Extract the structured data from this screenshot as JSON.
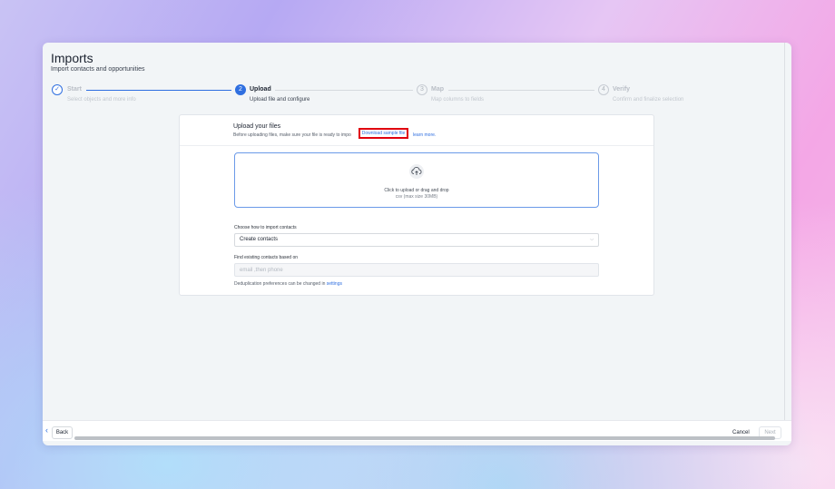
{
  "page": {
    "title": "Imports",
    "subtitle": "Import contacts and opportunities"
  },
  "steps": [
    {
      "number": "✓",
      "title": "Start",
      "desc": "Select objects and more info",
      "state": "done"
    },
    {
      "number": "2",
      "title": "Upload",
      "desc": "Upload file and configure",
      "state": "active"
    },
    {
      "number": "3",
      "title": "Map",
      "desc": "Map columns to fields",
      "state": "todo"
    },
    {
      "number": "4",
      "title": "Verify",
      "desc": "Confirm and finalize selection",
      "state": "todo"
    }
  ],
  "upload": {
    "title": "Upload your files",
    "instruction": "Before uploading files, make sure your file is ready to impo",
    "download_link": "Download sample file",
    "learn_link": "learn more.",
    "icon": "upload-cloud-icon",
    "dropzone_line1": "Click to upload or drag and drop",
    "dropzone_line2": "csv (max size 30MB)"
  },
  "import_mode": {
    "label": "Choose how to import contacts",
    "selected": "Create contacts"
  },
  "dedupe": {
    "label": "Find existing contacts based on",
    "placeholder": "email ,then phone",
    "note_prefix": "Deduplication preferences can be changed in",
    "note_link": "settings"
  },
  "footer": {
    "back": "Back",
    "cancel": "Cancel",
    "next": "Next"
  },
  "colors": {
    "accent": "#2f6fe0",
    "highlight_box": "#e0000f"
  }
}
